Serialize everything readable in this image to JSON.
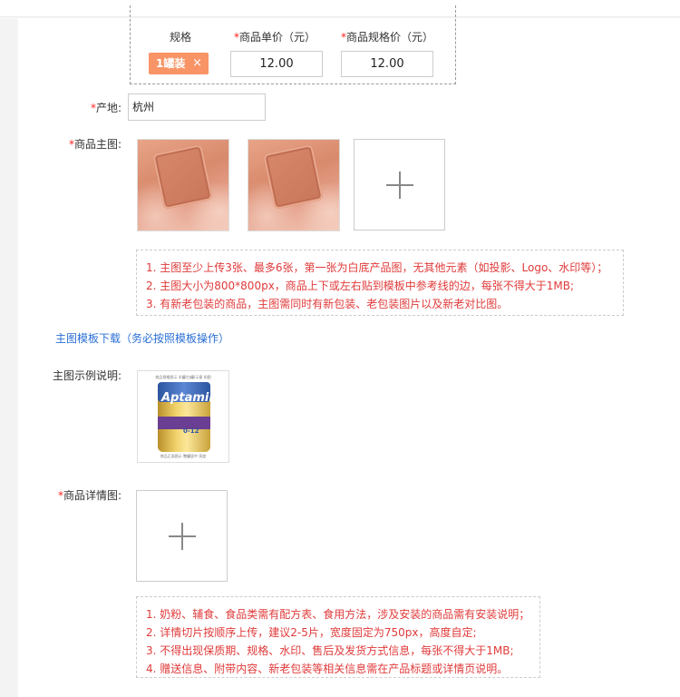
{
  "spec": {
    "col_spec": "规格",
    "col_unit_price": "商品单价（元）",
    "col_spec_price": "商品规格价（元）",
    "tag_label": "1罐装",
    "tag_close": "×",
    "unit_price": "12.00",
    "spec_price": "12.00"
  },
  "origin": {
    "label": "产地:",
    "value": "杭州"
  },
  "main_images": {
    "label": "商品主图:",
    "notes": [
      "1. 主图至少上传3张、最多6张，第一张为白底产品图，无其他元素（如投影、Logo、水印等）；",
      "2. 主图大小为800*800px，商品上下或左右贴到模板中参考线的边，每张不得大于1MB;",
      "3. 有新老包装的商品，主图需同时有新包装、老包装图片以及新老对比图。"
    ]
  },
  "template_link": "主图模板下载（务必按照模板操作）",
  "example": {
    "label": "主图示例说明:",
    "caption_top": "商品规格图示 半罐/白罐/示意 如图",
    "caption_bottom": "商品正面图示 整罐居中  亮度",
    "brand": "Aptamil",
    "age": "0-12"
  },
  "detail_images": {
    "label": "商品详情图:",
    "notes": [
      "1. 奶粉、辅食、食品类需有配方表、食用方法，涉及安装的商品需有安装说明；",
      "2. 详情切片按顺序上传，建议2-5片，宽度固定为750px，高度自定;",
      "3. 不得出现保质期、规格、水印、售后及发货方式信息，每张不得大于1MB;",
      "4. 赠送信息、附带内容、新老包装等相关信息需在产品标题或详情页说明。"
    ]
  },
  "required_mark": "*",
  "colors": {
    "required": "#ff2222",
    "notes": "#e03a3a",
    "link": "#2a6fd6",
    "tag": "#f89466"
  }
}
